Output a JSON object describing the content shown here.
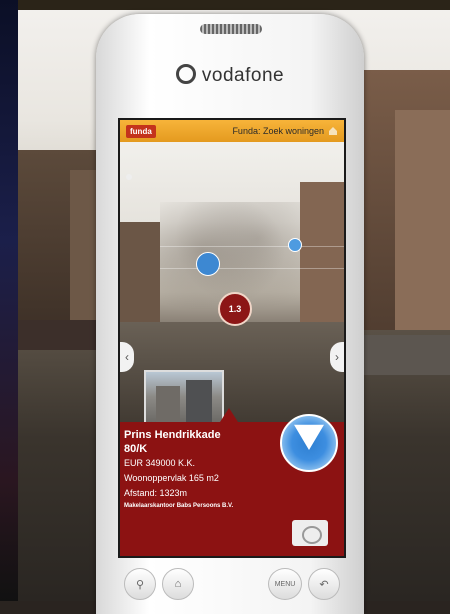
{
  "operator": {
    "name": "vodafone"
  },
  "app": {
    "logo_text": "funda",
    "title": "Funda: Zoek woningen"
  },
  "ar_view": {
    "selected_poi_label": "1.3"
  },
  "listing": {
    "street": "Prins Hendrikkade",
    "number": "80/K",
    "price": "EUR 349000 K.K.",
    "area": "Woonoppervlak 165 m2",
    "distance": "Afstand: 1323m",
    "agent": "Makelaarskantoor Babs Persoons B.V."
  },
  "hardware_buttons": {
    "search_icon": "magnifier",
    "home_icon": "house",
    "menu_label": "MENU",
    "back_icon": "back-arrow"
  },
  "colors": {
    "appbar": "#f0a52a",
    "info_panel": "#8c1212",
    "poi_blue": "#3d88d2"
  }
}
